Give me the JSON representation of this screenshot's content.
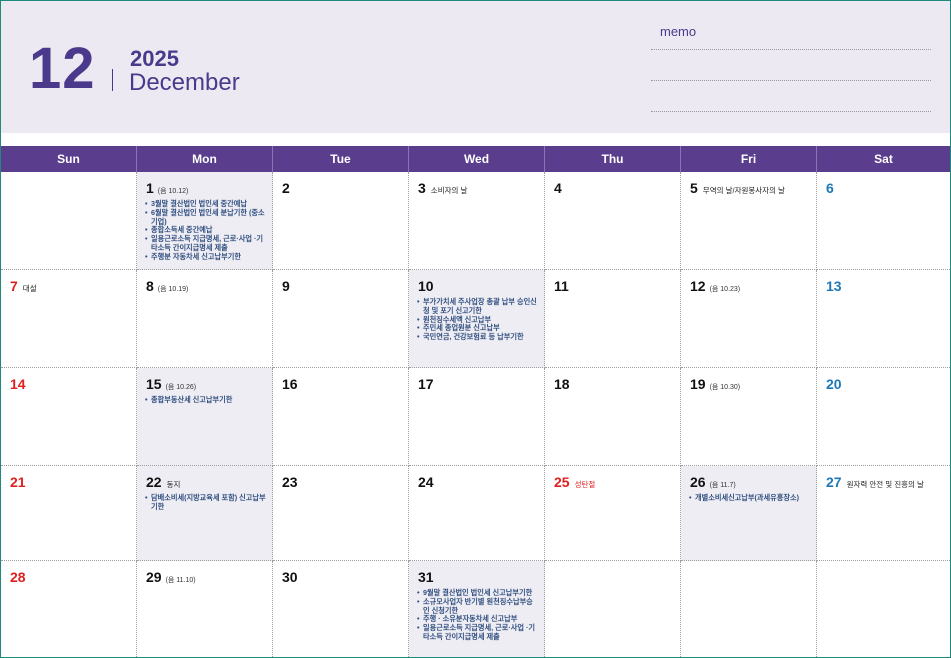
{
  "header": {
    "month_number": "12",
    "year": "2025",
    "month_name": "December",
    "memo_label": "memo"
  },
  "weekdays": [
    "Sun",
    "Mon",
    "Tue",
    "Wed",
    "Thu",
    "Fri",
    "Sat"
  ],
  "weeks": [
    [
      {
        "day": "",
        "note": "",
        "lunar": "",
        "events": []
      },
      {
        "day": "1",
        "lunar": "(음 10.12)",
        "note": "",
        "events": [
          "3월말 결산법인 법인세 중간예납",
          "6월말 결산법인 법인세 분납기한 (중소기업)",
          "종합소득세 중간예납",
          "일용근로소득 지급명세, 근로·사업 ·기타소득 간이지급명세 제출",
          "주행분 자동차세 신고납부기한"
        ]
      },
      {
        "day": "2",
        "lunar": "",
        "note": "",
        "events": []
      },
      {
        "day": "3",
        "lunar": "",
        "note": "소비자의 날",
        "events": []
      },
      {
        "day": "4",
        "lunar": "",
        "note": "",
        "events": []
      },
      {
        "day": "5",
        "lunar": "",
        "note": "무역의 날/자원봉사자의 날",
        "events": []
      },
      {
        "day": "6",
        "lunar": "",
        "note": "",
        "events": []
      }
    ],
    [
      {
        "day": "7",
        "lunar": "",
        "note": "대설",
        "events": []
      },
      {
        "day": "8",
        "lunar": "(음 10.19)",
        "note": "",
        "events": []
      },
      {
        "day": "9",
        "lunar": "",
        "note": "",
        "events": []
      },
      {
        "day": "10",
        "lunar": "",
        "note": "",
        "events": [
          "부가가치세 주사업장 총괄 납부 승인신청 및 포기 신고기한",
          "원천징수세액 신고납부",
          "주민세 종업원분 신고납부",
          "국민연금, 건강보험료 등 납부기한"
        ]
      },
      {
        "day": "11",
        "lunar": "",
        "note": "",
        "events": []
      },
      {
        "day": "12",
        "lunar": "(음 10.23)",
        "note": "",
        "events": []
      },
      {
        "day": "13",
        "lunar": "",
        "note": "",
        "events": []
      }
    ],
    [
      {
        "day": "14",
        "lunar": "",
        "note": "",
        "events": []
      },
      {
        "day": "15",
        "lunar": "(음 10.26)",
        "note": "",
        "events": [
          "종합부동산세 신고납부기한"
        ]
      },
      {
        "day": "16",
        "lunar": "",
        "note": "",
        "events": []
      },
      {
        "day": "17",
        "lunar": "",
        "note": "",
        "events": []
      },
      {
        "day": "18",
        "lunar": "",
        "note": "",
        "events": []
      },
      {
        "day": "19",
        "lunar": "(음 10.30)",
        "note": "",
        "events": []
      },
      {
        "day": "20",
        "lunar": "",
        "note": "",
        "events": []
      }
    ],
    [
      {
        "day": "21",
        "lunar": "",
        "note": "",
        "events": []
      },
      {
        "day": "22",
        "lunar": "",
        "note": "동지",
        "events": [
          "담배소비세(지방교육세 포함) 신고납부기한"
        ]
      },
      {
        "day": "23",
        "lunar": "",
        "note": "",
        "events": []
      },
      {
        "day": "24",
        "lunar": "",
        "note": "",
        "events": []
      },
      {
        "day": "25",
        "lunar": "",
        "note": "성탄절",
        "holiday": true,
        "events": []
      },
      {
        "day": "26",
        "lunar": "(음 11.7)",
        "note": "",
        "events": [
          "개별소비세신고납부(과세유흥장소)"
        ]
      },
      {
        "day": "27",
        "lunar": "",
        "note": "원자력 안전 및 진흥의 날",
        "events": []
      }
    ],
    [
      {
        "day": "28",
        "lunar": "",
        "note": "",
        "events": []
      },
      {
        "day": "29",
        "lunar": "(음 11.10)",
        "note": "",
        "events": []
      },
      {
        "day": "30",
        "lunar": "",
        "note": "",
        "events": []
      },
      {
        "day": "31",
        "lunar": "",
        "note": "",
        "events": [
          "9월말 결산법인 법인세 신고납부기한",
          "소규모사업자 반기별 원천징수납부승인 신청기한",
          "주행 · 소유분자동차세 신고납부",
          "일용근로소득 지급명세, 근로·사업 ·기타소득 간이지급명세 제출"
        ]
      },
      {
        "day": "",
        "lunar": "",
        "note": "",
        "events": []
      },
      {
        "day": "",
        "lunar": "",
        "note": "",
        "events": []
      },
      {
        "day": "",
        "lunar": "",
        "note": "",
        "events": []
      }
    ]
  ],
  "colors": {
    "header_bg": "#ece9f2",
    "accent": "#5a3d8c",
    "sunday": "#e02020",
    "saturday": "#1e78b8",
    "shaded_cell": "#efedf4",
    "event_text": "#2f4f7f"
  }
}
